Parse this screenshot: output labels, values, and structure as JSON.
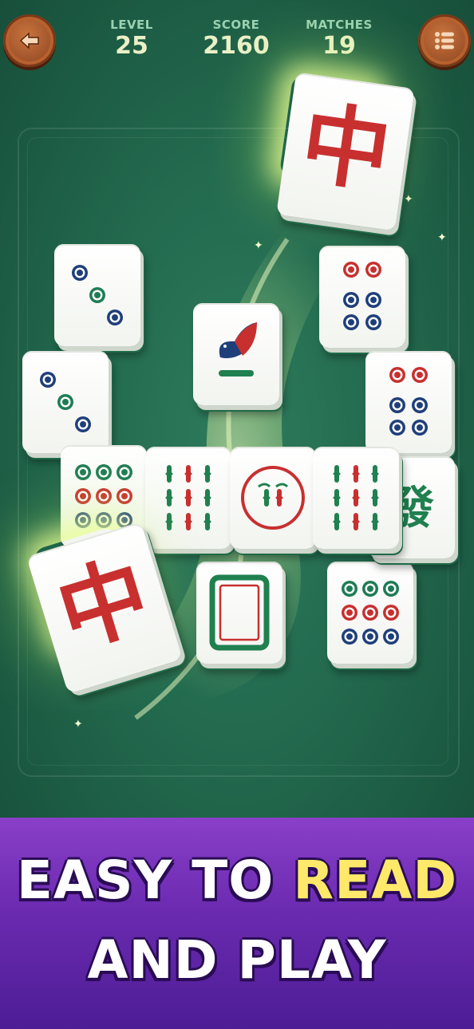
{
  "hud": {
    "level_label": "LEVEL",
    "level_value": "25",
    "score_label": "SCORE",
    "score_value": "2160",
    "matches_label": "MATCHES",
    "matches_value": "19"
  },
  "buttons": {
    "back_icon": "arrow-left-icon",
    "menu_icon": "list-menu-icon"
  },
  "tiles": [
    {
      "name": "tile-red-dragon-top",
      "type": "red-dragon",
      "glyph": "中"
    },
    {
      "name": "tile-three-circles-a",
      "type": "circles-3"
    },
    {
      "name": "tile-six-circles-top",
      "type": "circles-6"
    },
    {
      "name": "tile-bird-bamboo",
      "type": "bamboo-1-bird"
    },
    {
      "name": "tile-three-circles-b",
      "type": "circles-3"
    },
    {
      "name": "tile-six-circles-right",
      "type": "circles-6"
    },
    {
      "name": "tile-nine-circles-row",
      "type": "circles-9"
    },
    {
      "name": "tile-nine-bamboo-a",
      "type": "bamboo-9"
    },
    {
      "name": "tile-one-bamboo-circle",
      "type": "bamboo-circle"
    },
    {
      "name": "tile-nine-bamboo-b",
      "type": "bamboo-9"
    },
    {
      "name": "tile-green-dragon",
      "type": "green-dragon",
      "glyph": "發"
    },
    {
      "name": "tile-white-dragon",
      "type": "white-dragon"
    },
    {
      "name": "tile-nine-circles-bottom",
      "type": "circles-9"
    },
    {
      "name": "tile-red-dragon-bottom",
      "type": "red-dragon",
      "glyph": "中"
    }
  ],
  "colors": {
    "circle_blue": "#1f3f7a",
    "circle_green": "#1e7c54",
    "circle_red": "#c7302f",
    "bamboo_green": "#20804f",
    "bamboo_red": "#c7302f",
    "banner_purple": "#6a2ab0",
    "highlight_yellow": "#ffe96a"
  },
  "banner": {
    "line1_a": "EASY TO ",
    "line1_b": "READ",
    "line2": "AND PLAY"
  }
}
